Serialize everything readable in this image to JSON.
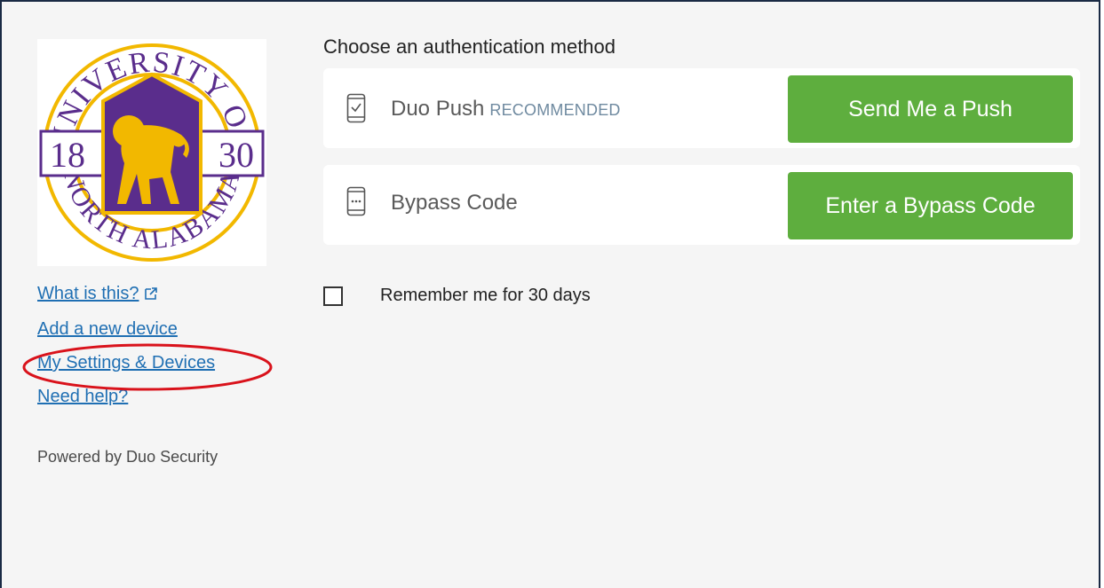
{
  "logo": {
    "top_text": "UNIVERSITY OF",
    "bottom_text": "NORTH ALABAMA",
    "year_left": "18",
    "year_right": "30",
    "colors": {
      "purple": "#5a2d8c",
      "gold": "#f2b800"
    }
  },
  "sidebar": {
    "links": [
      {
        "label": "What is this?",
        "icon": "external-link-icon"
      },
      {
        "label": "Add a new device"
      },
      {
        "label": "My Settings & Devices"
      },
      {
        "label": "Need help?"
      }
    ],
    "powered_by": "Powered by Duo Security"
  },
  "main": {
    "heading": "Choose an authentication method",
    "methods": [
      {
        "icon": "phone-check-icon",
        "label": "Duo Push",
        "badge": "RECOMMENDED",
        "button": "Send Me a Push"
      },
      {
        "icon": "phone-dots-icon",
        "label": "Bypass Code",
        "badge": "",
        "button": "Enter a Bypass Code"
      }
    ],
    "remember_label": "Remember me for 30 days"
  },
  "colors": {
    "button_green": "#5eae3e",
    "link_blue": "#1f6fb3",
    "highlight_red": "#d9121b",
    "background": "#f5f5f5"
  }
}
